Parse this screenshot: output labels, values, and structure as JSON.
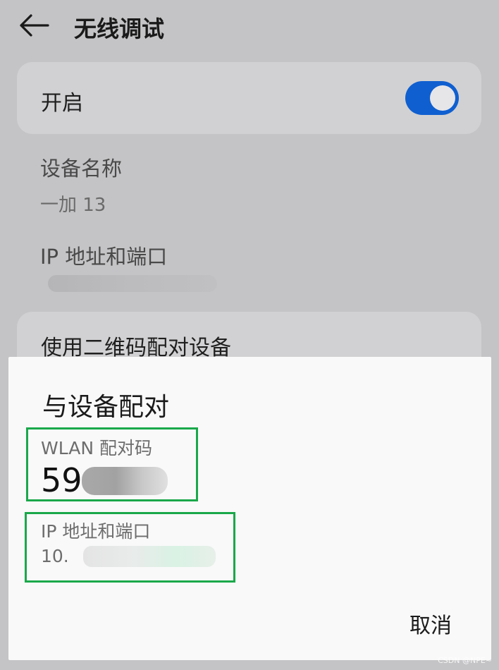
{
  "header": {
    "title": "无线调试",
    "back_icon": "arrow-left-icon"
  },
  "settings": {
    "enable_label": "开启",
    "enable_state": true,
    "device_name_title": "设备名称",
    "device_name_value": "一加 13",
    "ip_title": "IP 地址和端口",
    "qr_pair_label": "使用二维码配对设备"
  },
  "dialog": {
    "title": "与设备配对",
    "wlan_code_label": "WLAN 配对码",
    "wlan_code_value": "59",
    "ip_label": "IP 地址和端口",
    "ip_value": "10.",
    "cancel_label": "取消"
  },
  "colors": {
    "toggle_on": "#0f5fd0",
    "highlight_box": "#1aa84a",
    "background": "#c4c4c6"
  },
  "watermark": "CSDN @NPE~"
}
